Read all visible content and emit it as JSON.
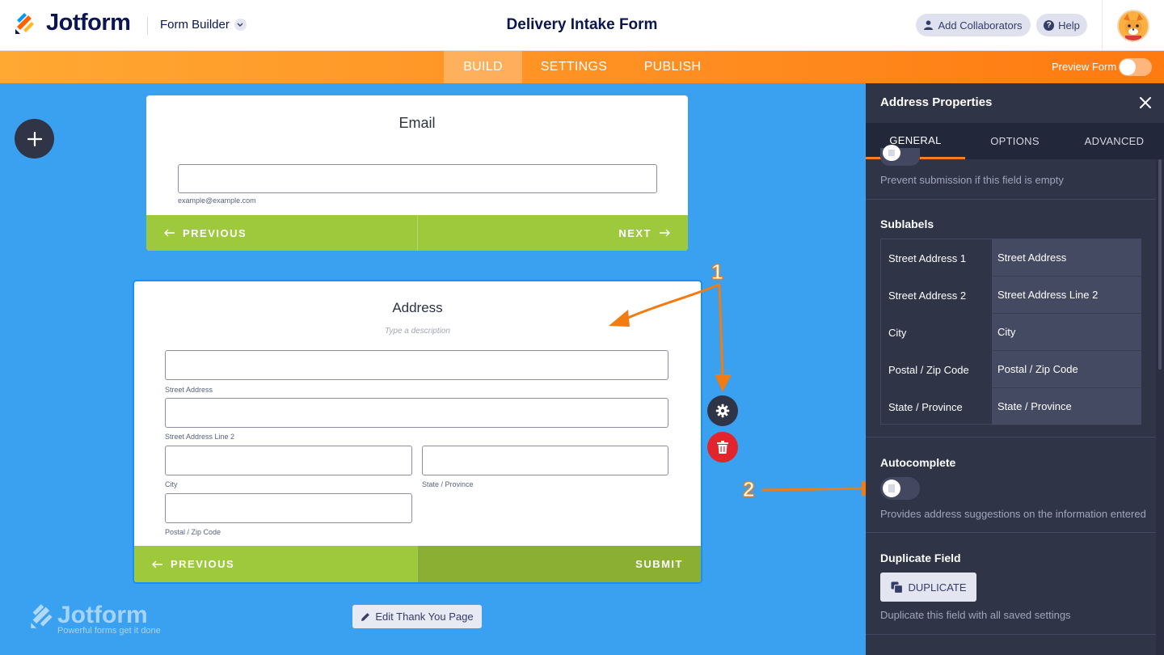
{
  "header": {
    "brand": "Jotform",
    "builder_menu": "Form Builder",
    "form_title": "Delivery Intake Form",
    "collaborators": "Add Collaborators",
    "help": "Help",
    "help_glyph": "?"
  },
  "nav": {
    "tabs": [
      "BUILD",
      "SETTINGS",
      "PUBLISH"
    ],
    "active_tab": "BUILD",
    "preview_label": "Preview Form",
    "preview_on": false
  },
  "email_card": {
    "title": "Email",
    "sublabel": "example@example.com",
    "prev": "PREVIOUS",
    "next": "NEXT"
  },
  "address_card": {
    "title": "Address",
    "description_placeholder": "Type a description",
    "sublabels": {
      "street1": "Street Address",
      "street2": "Street Address Line 2",
      "city": "City",
      "state": "State / Province",
      "postal": "Postal / Zip Code"
    },
    "prev": "PREVIOUS",
    "submit": "SUBMIT"
  },
  "edit_thank_you": "Edit Thank You Page",
  "watermark": {
    "brand": "Jotform",
    "tagline": "Powerful forms get it done"
  },
  "annotations": {
    "marker1": "1",
    "marker2": "2",
    "color": "#f07c12"
  },
  "panel": {
    "title": "Address Properties",
    "tabs": [
      "GENERAL",
      "OPTIONS",
      "ADVANCED"
    ],
    "active_tab": "GENERAL",
    "required_help": "Prevent submission if this field is empty",
    "sublabels_title": "Sublabels",
    "sublabels": [
      {
        "name": "Street Address 1",
        "value": "Street Address"
      },
      {
        "name": "Street Address 2",
        "value": "Street Address Line 2"
      },
      {
        "name": "City",
        "value": "City"
      },
      {
        "name": "Postal / Zip Code",
        "value": "Postal / Zip Code"
      },
      {
        "name": "State / Province",
        "value": "State / Province"
      }
    ],
    "autocomplete_title": "Autocomplete",
    "autocomplete_on": false,
    "autocomplete_help": "Provides address suggestions on the information entered",
    "duplicate_title": "Duplicate Field",
    "duplicate_button": "DUPLICATE",
    "duplicate_help": "Duplicate this field with all saved settings"
  },
  "colors": {
    "accent_orange": "#ff8d20",
    "canvas_blue": "#3aa0f0",
    "pager_green": "#9ec93c",
    "panel_bg": "#2f3447",
    "navy": "#0a1551",
    "delete_red": "#e2252c"
  }
}
